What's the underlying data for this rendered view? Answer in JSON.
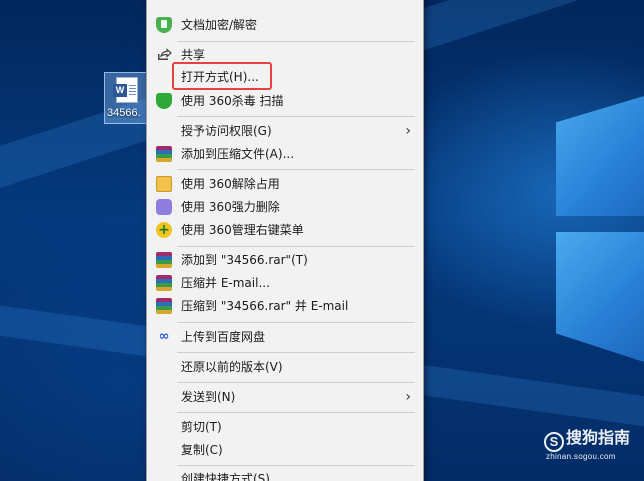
{
  "desktop": {
    "icon": {
      "label": "34566.",
      "glyph": "W"
    }
  },
  "menu": {
    "items": [
      {
        "id": "top-cut",
        "label": "",
        "icon": "rar-icon"
      },
      {
        "id": "encrypt",
        "label": "文档加密/解密",
        "icon": "green-shield-icon"
      },
      {
        "id": "share",
        "label": "共享",
        "icon": "share-icon"
      },
      {
        "id": "open-with",
        "label": "打开方式(H)...",
        "icon": ""
      },
      {
        "id": "scan-360",
        "label": "使用 360杀毒 扫描",
        "icon": "360-shield-icon"
      },
      {
        "id": "grant-access",
        "label": "授予访问权限(G)",
        "icon": "",
        "submenu": true
      },
      {
        "id": "add-archive",
        "label": "添加到压缩文件(A)...",
        "icon": "rar-icon"
      },
      {
        "id": "unlock-360",
        "label": "使用 360解除占用",
        "icon": "folder-lock-icon"
      },
      {
        "id": "force-delete-360",
        "label": "使用 360强力删除",
        "icon": "shredder-icon"
      },
      {
        "id": "manage-menu-360",
        "label": "使用 360管理右键菜单",
        "icon": "plus-circle-icon"
      },
      {
        "id": "add-to-rar",
        "label": "添加到 \"34566.rar\"(T)",
        "icon": "rar-icon"
      },
      {
        "id": "compress-email",
        "label": "压缩并 E-mail...",
        "icon": "rar-icon"
      },
      {
        "id": "compress-rar-email",
        "label": "压缩到 \"34566.rar\" 并 E-mail",
        "icon": "rar-icon"
      },
      {
        "id": "upload-baidu",
        "label": "上传到百度网盘",
        "icon": "baidu-cloud-icon"
      },
      {
        "id": "restore-versions",
        "label": "还原以前的版本(V)",
        "icon": ""
      },
      {
        "id": "send-to",
        "label": "发送到(N)",
        "icon": "",
        "submenu": true
      },
      {
        "id": "cut",
        "label": "剪切(T)",
        "icon": ""
      },
      {
        "id": "copy",
        "label": "复制(C)",
        "icon": ""
      },
      {
        "id": "create-shortcut",
        "label": "创建快捷方式(S)",
        "icon": ""
      }
    ]
  },
  "watermark": {
    "brand": "搜狗指南",
    "domain": "zhinan.sogou.com",
    "logo": "S"
  },
  "colors": {
    "highlight_box": "#e84040",
    "menu_bg": "#f2f2f2"
  }
}
